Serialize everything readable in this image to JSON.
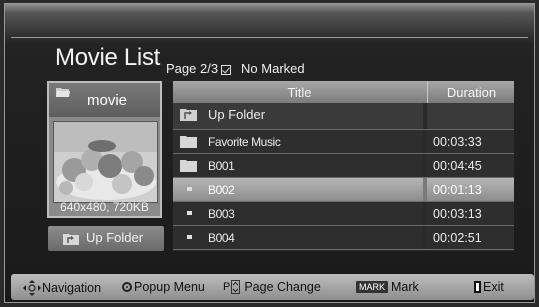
{
  "header": {
    "title": "Movie List",
    "page_info": "Page 2/3",
    "marked_status": "No Marked"
  },
  "preview": {
    "folder_name": "movie",
    "resolution_info": "640x480, 720KB",
    "up_folder_label": "Up Folder"
  },
  "list": {
    "col_title": "Title",
    "col_duration": "Duration",
    "up_folder_row": "Up Folder",
    "items": [
      {
        "name": "Favorite Music",
        "duration": "00:03:33",
        "type": "folder"
      },
      {
        "name": "B001",
        "duration": "00:04:45",
        "type": "folder"
      },
      {
        "name": "B002",
        "duration": "00:01:13",
        "type": "file",
        "selected": true
      },
      {
        "name": "B003",
        "duration": "00:03:13",
        "type": "file"
      },
      {
        "name": "B004",
        "duration": "00:02:51",
        "type": "file"
      }
    ]
  },
  "footer": {
    "navigation": "Navigation",
    "popup_menu": "Popup Menu",
    "page_prefix": "P",
    "page_change": "Page Change",
    "mark_key": "MARK",
    "mark": "Mark",
    "exit": "Exit"
  },
  "icons": [
    "folder-icon",
    "up-folder-icon",
    "file-icon",
    "navigation-arrows-icon",
    "enter-circle-icon",
    "page-updown-icon",
    "exit-icon",
    "checkbox-icon"
  ]
}
